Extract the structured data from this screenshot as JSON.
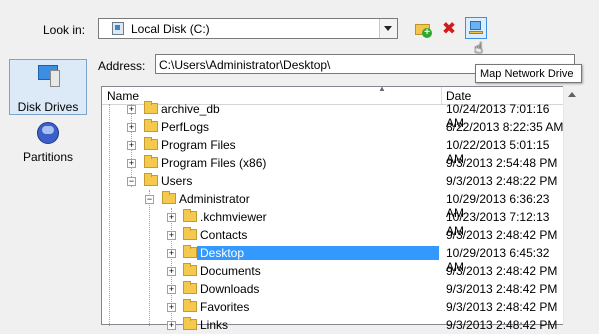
{
  "lookin": {
    "label": "Look in:",
    "value": "Local Disk (C:)"
  },
  "toolbar": {
    "new_folder_icon": "new-folder-icon",
    "delete_icon": "delete-icon",
    "map_drive_icon": "map-network-drive-icon",
    "tooltip": "Map Network Drive"
  },
  "address": {
    "label": "Address:",
    "value": "C:\\Users\\Administrator\\Desktop\\"
  },
  "nav": [
    {
      "label": "Disk Drives",
      "icon": "disk-drives-icon",
      "selected": true
    },
    {
      "label": "Partitions",
      "icon": "partitions-icon",
      "selected": false
    }
  ],
  "tree": {
    "columns": {
      "name": "Name",
      "date": "Date"
    },
    "rows": [
      {
        "name": "archive_db",
        "date": "10/24/2013 7:01:16 AM",
        "level": 1,
        "expander": "+"
      },
      {
        "name": "PerfLogs",
        "date": "8/22/2013 8:22:35 AM",
        "level": 1,
        "expander": "+"
      },
      {
        "name": "Program Files",
        "date": "10/22/2013 5:01:15 AM",
        "level": 1,
        "expander": "+"
      },
      {
        "name": "Program Files (x86)",
        "date": "9/3/2013 2:54:48 PM",
        "level": 1,
        "expander": "+"
      },
      {
        "name": "Users",
        "date": "9/3/2013 2:48:22 PM",
        "level": 1,
        "expander": "-"
      },
      {
        "name": "Administrator",
        "date": "10/29/2013 6:36:23 AM",
        "level": 2,
        "expander": "-"
      },
      {
        "name": ".kchmviewer",
        "date": "10/23/2013 7:12:13 AM",
        "level": 3,
        "expander": "+"
      },
      {
        "name": "Contacts",
        "date": "9/3/2013 2:48:42 PM",
        "level": 3,
        "expander": "+"
      },
      {
        "name": "Desktop",
        "date": "10/29/2013 6:45:32 AM",
        "level": 3,
        "expander": "+",
        "selected": true
      },
      {
        "name": "Documents",
        "date": "9/3/2013 2:48:42 PM",
        "level": 3,
        "expander": "+"
      },
      {
        "name": "Downloads",
        "date": "9/3/2013 2:48:42 PM",
        "level": 3,
        "expander": "+"
      },
      {
        "name": "Favorites",
        "date": "9/3/2013 2:48:42 PM",
        "level": 3,
        "expander": "+"
      },
      {
        "name": "Links",
        "date": "9/3/2013 2:48:42 PM",
        "level": 3,
        "expander": "+"
      }
    ]
  },
  "colors": {
    "selection": "#3399ff",
    "folder": "#f5c94e",
    "nav_selected": "#dceaf8"
  }
}
